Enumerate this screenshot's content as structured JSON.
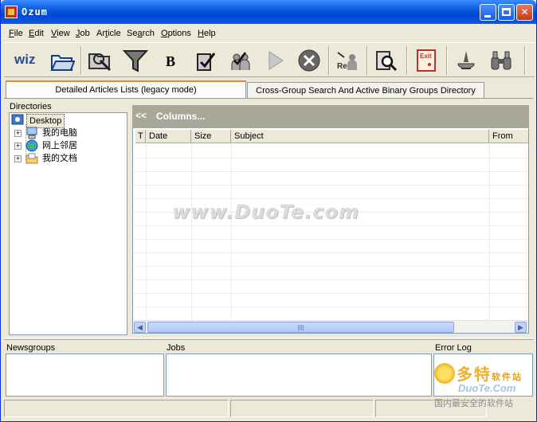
{
  "window": {
    "title": "Ozum"
  },
  "menu": [
    {
      "accel": "F",
      "rest": "ile"
    },
    {
      "accel": "E",
      "rest": "dit"
    },
    {
      "accel": "V",
      "rest": "iew"
    },
    {
      "accel": "J",
      "rest": "ob"
    },
    {
      "pre": "Ar",
      "accel": "t",
      "rest": "icle"
    },
    {
      "pre": "Se",
      "accel": "a",
      "rest": "rch"
    },
    {
      "accel": "O",
      "rest": "ptions"
    },
    {
      "accel": "H",
      "rest": "elp"
    }
  ],
  "toolbar": {
    "wizard_text": "wiz",
    "bold_text": "B",
    "re_text": "Re",
    "exit_text": "Exit"
  },
  "tabs": [
    {
      "label": "Detailed Articles Lists (legacy mode)"
    },
    {
      "label": "Cross-Group Search And Active Binary Groups Directory"
    }
  ],
  "directories": {
    "label": "Directories",
    "root": "Desktop",
    "children": [
      "我的电脑",
      "网上邻居",
      "我的文档"
    ]
  },
  "articles": {
    "nav": "<<",
    "columns_label": "Columns...",
    "headers": [
      "T",
      "Date",
      "Size",
      "Subject",
      "From"
    ]
  },
  "watermark": {
    "main": "www.DuoTe.com",
    "corner_cn": "多特",
    "corner_small": "软件站",
    "corner_en": "DuoTe.Com",
    "corner_slogan": "国内最安全的软件站"
  },
  "panes": {
    "newsgroups": "Newsgroups",
    "jobs": "Jobs",
    "errorlog": "Error Log"
  }
}
